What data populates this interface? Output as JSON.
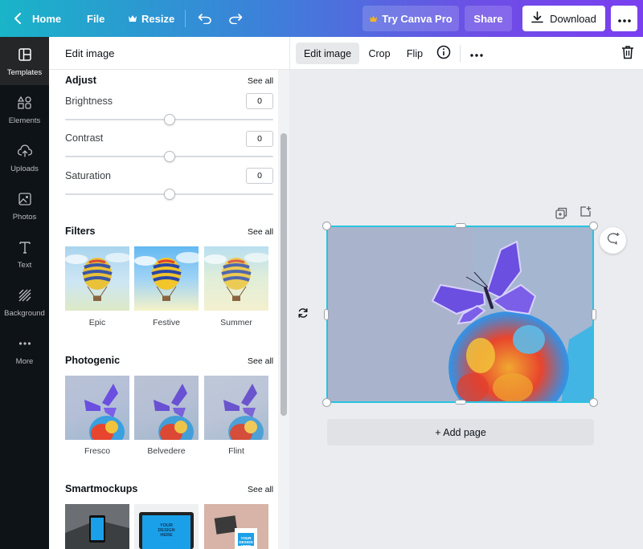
{
  "topbar": {
    "home": "Home",
    "file": "File",
    "resize": "Resize",
    "try_pro": "Try Canva Pro",
    "share": "Share",
    "download": "Download"
  },
  "rail": {
    "items": [
      {
        "label": "Templates",
        "icon": "templates-icon"
      },
      {
        "label": "Elements",
        "icon": "elements-icon"
      },
      {
        "label": "Uploads",
        "icon": "uploads-icon"
      },
      {
        "label": "Photos",
        "icon": "photos-icon"
      },
      {
        "label": "Text",
        "icon": "text-icon"
      },
      {
        "label": "Background",
        "icon": "background-icon"
      },
      {
        "label": "More",
        "icon": "more-icon"
      }
    ]
  },
  "panel": {
    "title": "Edit image",
    "adjust": {
      "title": "Adjust",
      "see_all": "See all",
      "brightness": {
        "label": "Brightness",
        "value": "0"
      },
      "contrast": {
        "label": "Contrast",
        "value": "0"
      },
      "saturation": {
        "label": "Saturation",
        "value": "0"
      }
    },
    "filters": {
      "title": "Filters",
      "see_all": "See all",
      "items": [
        "Epic",
        "Festive",
        "Summer"
      ]
    },
    "photogenic": {
      "title": "Photogenic",
      "see_all": "See all",
      "items": [
        "Fresco",
        "Belvedere",
        "Flint"
      ]
    },
    "smartmockups": {
      "title": "Smartmockups",
      "see_all": "See all",
      "mockup_text": [
        "YOUR",
        "DESIGN",
        "HERE"
      ]
    }
  },
  "edit_toolbar": {
    "edit_image": "Edit image",
    "crop": "Crop",
    "flip": "Flip"
  },
  "canvas": {
    "add_page": "+ Add page"
  },
  "colors": {
    "accent_cyan": "#27c3e0",
    "rail_bg": "#0e1318",
    "gradient_start": "#19b4c8",
    "gradient_end": "#7a3ff0"
  }
}
